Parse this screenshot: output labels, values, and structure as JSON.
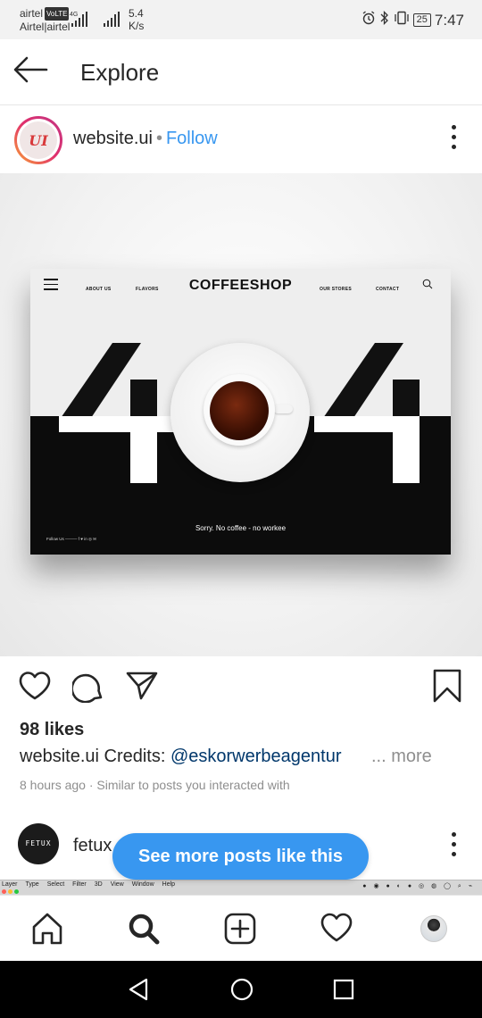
{
  "status_bar": {
    "carrier_top": "airtel",
    "volte": "VoLTE",
    "carrier_bottom": "Airtel|airtel",
    "network": "4G",
    "speed_value": "5.4",
    "speed_unit": "K/s",
    "battery": "25",
    "time": "7:47"
  },
  "header": {
    "title": "Explore"
  },
  "post": {
    "avatar_text": "UI",
    "username": "website.ui",
    "separator": "•",
    "follow_label": "Follow",
    "mockup": {
      "menu_items": [
        "ABOUT US",
        "FLAVORS",
        "OUR STORES",
        "CONTACT"
      ],
      "logo": "COFFEESHOP",
      "caption": "Sorry. No coffee - no workee",
      "follow_text": "Follow Us"
    },
    "likes": "98 likes",
    "caption_user": "website.ui",
    "caption_text": "Credits:",
    "caption_mention": "@eskorwerbeagentur",
    "more_label": "... more",
    "meta": "8 hours ago · Similar to posts you interacted with"
  },
  "next_post": {
    "avatar_text": "FETUX",
    "username": "fetux"
  },
  "see_more_button": "See more posts like this",
  "ps_strip": {
    "menu": [
      "Layer",
      "Type",
      "Select",
      "Filter",
      "3D",
      "View",
      "Window",
      "Help"
    ]
  },
  "tabs": [
    "home-icon",
    "search-icon",
    "new-post-icon",
    "activity-icon",
    "profile-avatar"
  ],
  "colors": {
    "link_blue": "#3897f0",
    "text": "#262626",
    "muted": "#8e8e8e"
  }
}
